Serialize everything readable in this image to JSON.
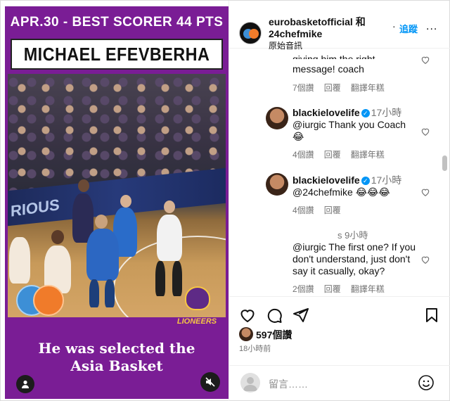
{
  "media": {
    "date_label": "APR.30 - BEST SCORER 44 PTS",
    "player_name": "MICHAEL EFEVBERHA",
    "ad_board_text": "RIOUS",
    "team_logo_text": "LIONEERS",
    "caption_line1": "He was selected the",
    "caption_line2": "Asia Basket"
  },
  "header": {
    "account": "eurobasketofficial",
    "joiner": " 和",
    "coauthor": "24chefmike",
    "audio": "原始音訊",
    "dot": "·",
    "follow": "追蹤",
    "more": "..."
  },
  "comments": [
    {
      "text_partial": "giving him the right",
      "text": "message! coach",
      "likes": "7個讚",
      "reply": "回覆",
      "translate": "翻譯年糕"
    },
    {
      "username": "blackielovelife",
      "time": "17小時",
      "mention": "@iurgic",
      "text": " Thank you Coach",
      "emoji": "😂",
      "likes": "4個讚",
      "reply": "回覆",
      "translate": "翻譯年糕"
    },
    {
      "username": "blackielovelife",
      "time": "17小時",
      "mention": "@24chefmike",
      "emoji": "😂😂😂",
      "likes": "4個讚",
      "reply": "回覆"
    },
    {
      "username_partial": "s",
      "time": "9小時",
      "mention": "@iurgic",
      "text": " The first one? If you don't understand, just don't say it casually, okay?",
      "likes": "2個讚",
      "reply": "回覆",
      "translate": "翻譯年糕"
    }
  ],
  "actions": {
    "likes": "597個讚",
    "time": "18小時前"
  },
  "add_comment": {
    "placeholder": "留言……"
  },
  "colors": {
    "media_bg": "#7a1d95",
    "link_blue": "#0095f6",
    "muted": "#737373"
  }
}
